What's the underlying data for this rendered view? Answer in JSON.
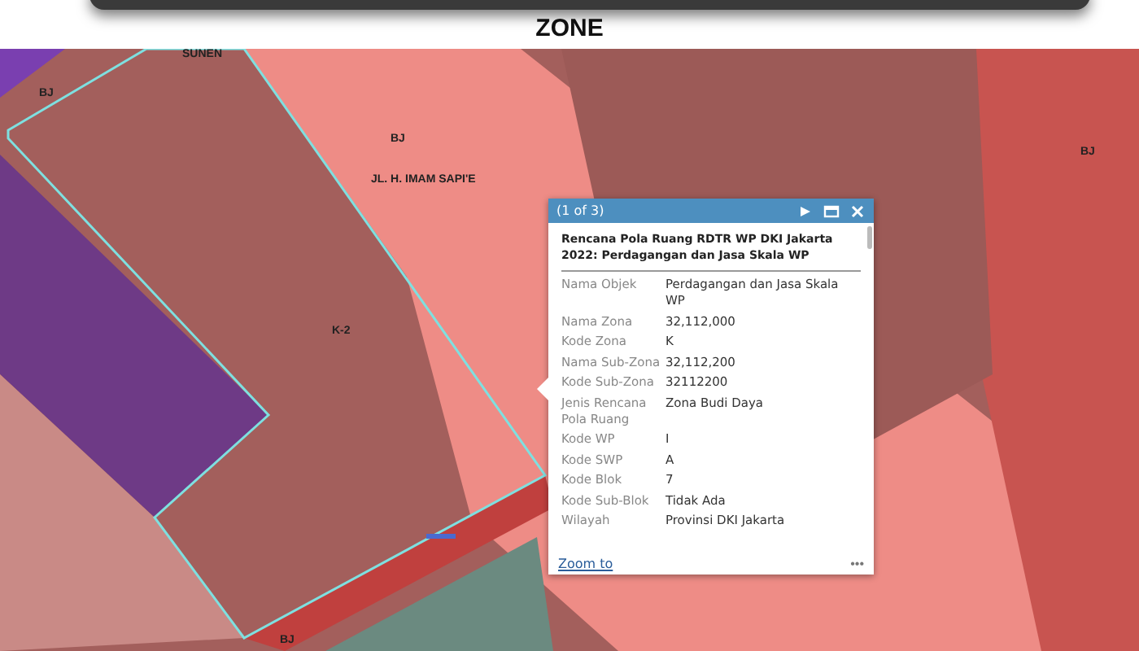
{
  "header": {
    "title": "ZONE"
  },
  "map": {
    "labels": [
      "SUNEN",
      "BJ",
      "BJ",
      "JL. H. IMAM SAPI'E",
      "BJ",
      "K-2",
      "BJ"
    ]
  },
  "popup": {
    "counter": "(1 of 3)",
    "title": "Rencana Pola Ruang RDTR WP DKI Jakarta 2022: Perdagangan dan Jasa Skala WP",
    "fields": [
      {
        "label": "Nama Objek",
        "value": "Perdagangan dan Jasa Skala WP"
      },
      {
        "label": "Nama Zona",
        "value": "32,112,000"
      },
      {
        "label": "Kode Zona",
        "value": "K"
      },
      {
        "label": "Nama Sub-Zona",
        "value": "32,112,200"
      },
      {
        "label": "Kode Sub-Zona",
        "value": "32112200"
      },
      {
        "label": "Jenis Rencana Pola Ruang",
        "value": "Zona Budi Daya"
      },
      {
        "label": "Kode WP",
        "value": "I"
      },
      {
        "label": "Kode SWP",
        "value": "A"
      },
      {
        "label": "Kode Blok",
        "value": "7"
      },
      {
        "label": "Kode Sub-Blok",
        "value": "Tidak Ada"
      },
      {
        "label": "Wilayah",
        "value": "Provinsi DKI Jakarta"
      }
    ],
    "zoom_link": "Zoom to",
    "more": "•••"
  }
}
